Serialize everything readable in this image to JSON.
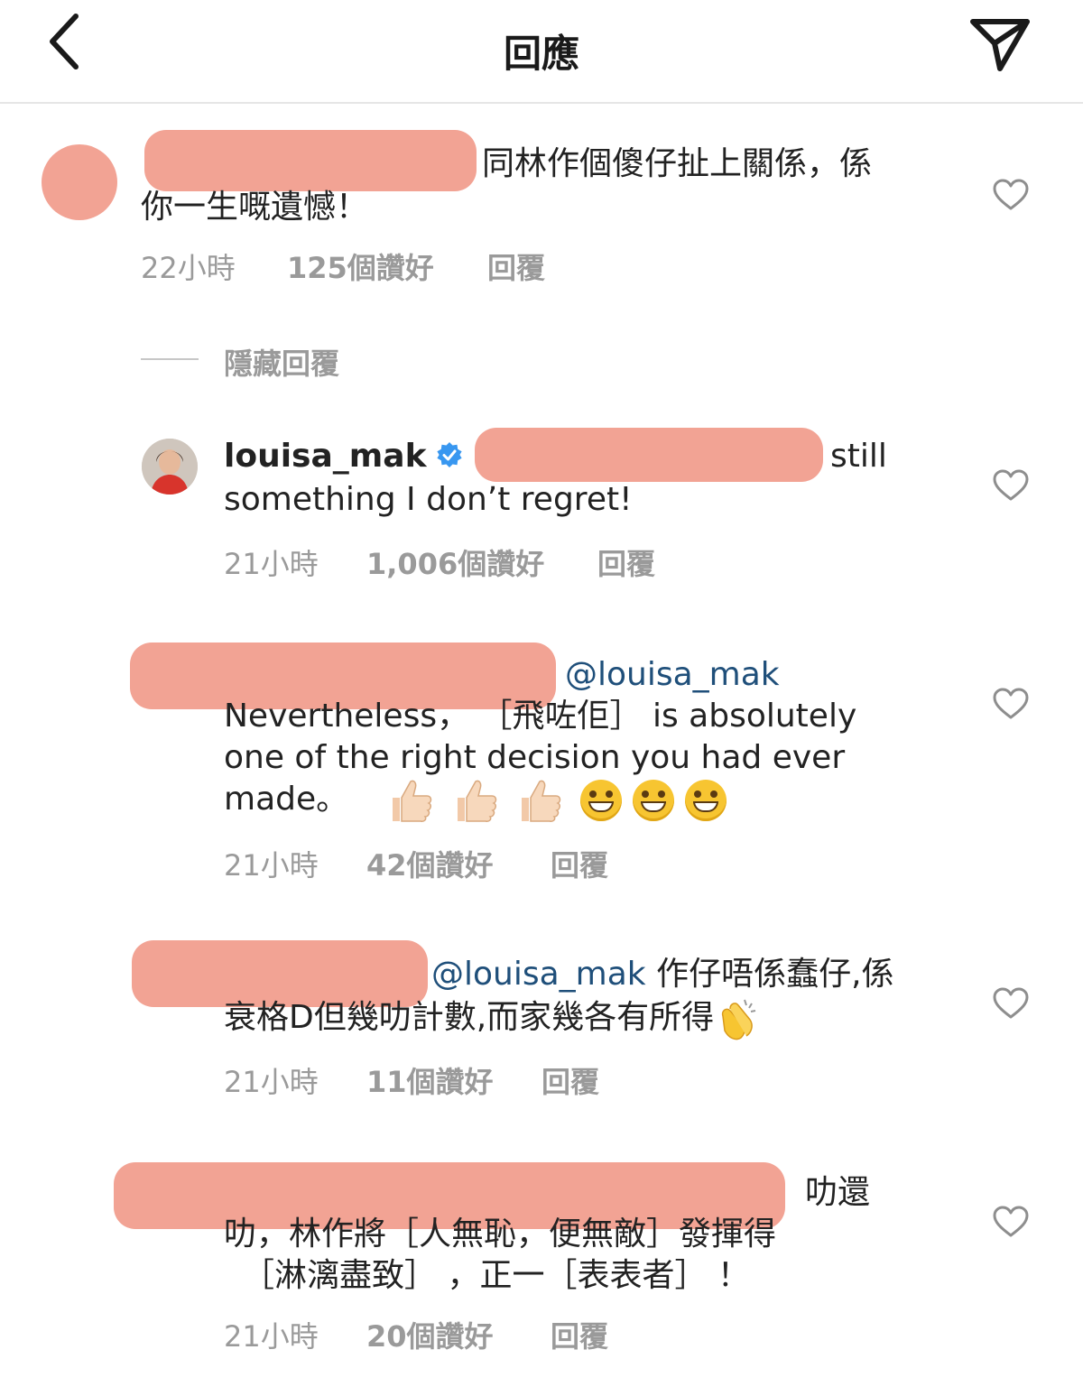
{
  "header": {
    "title": "回應",
    "back_icon": "chevron-left-icon",
    "send_icon": "paper-plane-icon"
  },
  "comments": [
    {
      "text_line1": "同林作個傻仔扯上關係，係",
      "text_line2": "你一生嘅遺憾！",
      "time": "22小時",
      "likes": "125個讚好",
      "reply": "回覆"
    },
    {
      "username": "louisa_mak",
      "verified": true,
      "text_line1": "still",
      "text_line2": "something I don’t regret!",
      "time": "21小時",
      "likes": "1,006個讚好",
      "reply": "回覆"
    },
    {
      "mention": "@louisa_mak",
      "text_line1": "Nevertheless， ［飛咗佢］ is absolutely",
      "text_line2": "one of the right decision you had ever",
      "text_line3": "made。",
      "time": "21小時",
      "likes": "42個讚好",
      "reply": "回覆"
    },
    {
      "mention": "@louisa_mak",
      "text_line1": "作仔唔係蠢仔,係",
      "text_line2": "衰格D但幾叻計數,而家幾各有所得",
      "time": "21小時",
      "likes": "11個讚好",
      "reply": "回覆"
    },
    {
      "text_line1": "叻還",
      "text_line2": "叻，林作將［人無恥，便無敵］發揮得",
      "text_line3": "［淋漓盡致］ ，正一［表表者］ ！",
      "time": "21小時",
      "likes": "20個讚好",
      "reply": "回覆"
    }
  ],
  "hide_replies": "隱藏回覆",
  "colors": {
    "redaction": "#f2a394",
    "meta": "#9a9a9a",
    "mention": "#1f4f7a",
    "verified": "#3897f0"
  }
}
